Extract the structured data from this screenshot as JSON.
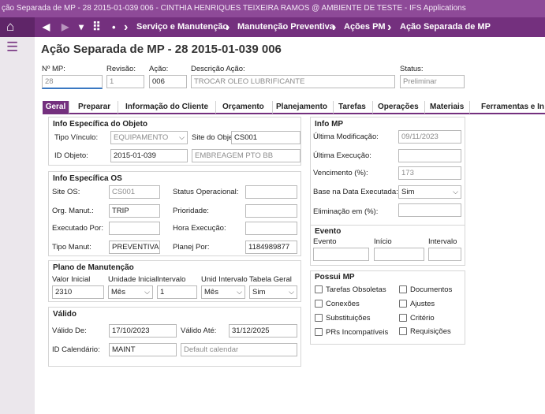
{
  "titlebar": {
    "text": "ção Separada de MP - 28 2015-01-039 006 - CINTHIA HENRIQUES TEIXEIRA RAMOS @ AMBIENTE DE TESTE - IFS Applications"
  },
  "nav": {
    "home_glyph": "⌂",
    "back_glyph": "◀",
    "forward_glyph": "▶",
    "dropdown_glyph": "▾",
    "grid_glyph": "⠿",
    "dot_glyph": "•",
    "sep_glyph": "›",
    "breadcrumbs": [
      "Serviço e Manutenção",
      "Manutenção Preventiva",
      "Ações PM",
      "Ação Separada de MP"
    ]
  },
  "sidebar": {
    "menu_glyph": "☰"
  },
  "page": {
    "title": "Ação Separada de MP - 28 2015-01-039 006"
  },
  "header_fields": {
    "nr_mp": {
      "label": "Nº MP:",
      "value": "28"
    },
    "revisao": {
      "label": "Revisão:",
      "value": "1"
    },
    "acao": {
      "label": "Ação:",
      "value": "006"
    },
    "descricao": {
      "label": "Descrição Ação:",
      "value": "TROCAR OLEO LUBRIFICANTE"
    },
    "status": {
      "label": "Status:",
      "value": "Preliminar"
    }
  },
  "tabs": [
    "Geral",
    "Preparar",
    "Informação do Cliente",
    "Orçamento",
    "Planejamento",
    "Tarefas",
    "Operações",
    "Materiais",
    "Ferramentas e In"
  ],
  "objeto": {
    "title": "Info Específica do Objeto",
    "tipo_vinculo": {
      "label": "Tipo Vínculo:",
      "value": "EQUIPAMENTO"
    },
    "site_objeto": {
      "label": "Site do Obje",
      "value": "CS001"
    },
    "id_objeto": {
      "label": "ID Objeto:",
      "value": "2015-01-039",
      "desc": "EMBREAGEM  PTO BB"
    }
  },
  "os": {
    "title": "Info Específica OS",
    "site_os": {
      "label": "Site OS:",
      "value": "CS001"
    },
    "status_op": {
      "label": "Status Operacional:",
      "value": ""
    },
    "org_manut": {
      "label": "Org. Manut.:",
      "value": "TRIP"
    },
    "prioridade": {
      "label": "Prioridade:",
      "value": ""
    },
    "executado_por": {
      "label": "Executado Por:",
      "value": ""
    },
    "hora_execucao": {
      "label": "Hora Execução:",
      "value": ""
    },
    "tipo_manut": {
      "label": "Tipo Manut:",
      "value": "PREVENTIVA"
    },
    "planej_por": {
      "label": "Planej Por:",
      "value": "1184989877"
    }
  },
  "plano": {
    "title": "Plano de Manutenção",
    "valor_inicial": {
      "label": "Valor Inicial",
      "value": "2310"
    },
    "unidade_inicial": {
      "label": "Unidade Inicial",
      "value": "Mês"
    },
    "intervalo": {
      "label": "Intervalo",
      "value": "1"
    },
    "unid_intervalo": {
      "label": "Unid Intervalo",
      "value": "Mês"
    },
    "tabela_geral": {
      "label": "Tabela Geral",
      "value": "Sim"
    }
  },
  "valido": {
    "title": "Válido",
    "valido_de": {
      "label": "Válido De:",
      "value": "17/10/2023"
    },
    "valido_ate": {
      "label": "Válido Até:",
      "value": "31/12/2025"
    },
    "id_calendario": {
      "label": "ID Calendário:",
      "value": "MAINT",
      "desc": "Default calendar"
    }
  },
  "info_mp": {
    "title": "Info MP",
    "ultima_modificacao": {
      "label": "Última Modificação:",
      "value": "09/11/2023"
    },
    "ultima_execucao": {
      "label": "Última Execução:",
      "value": ""
    },
    "vencimento": {
      "label": "Vencimento (%):",
      "value": "173"
    },
    "base_data": {
      "label": "Base na Data Executada:",
      "value": "Sim"
    },
    "eliminacao": {
      "label": "Eliminação em (%):",
      "value": ""
    }
  },
  "evento": {
    "title": "Evento",
    "evento": {
      "label": "Evento",
      "value": ""
    },
    "inicio": {
      "label": "Início",
      "value": ""
    },
    "intervalo": {
      "label": "Intervalo",
      "value": ""
    }
  },
  "possui": {
    "title": "Possui MP",
    "items": [
      "Tarefas Obsoletas",
      "Documentos",
      "Conexões",
      "Ajustes",
      "Substituições",
      "Critério",
      "PRs Incompatíveis",
      "Requisições"
    ]
  },
  "colors": {
    "title_bar": "#8e4a98",
    "nav_bar": "#74307e",
    "home_bg": "#5f2568",
    "tab_active": "#74307e",
    "sidebar": "#ebe7ec"
  }
}
